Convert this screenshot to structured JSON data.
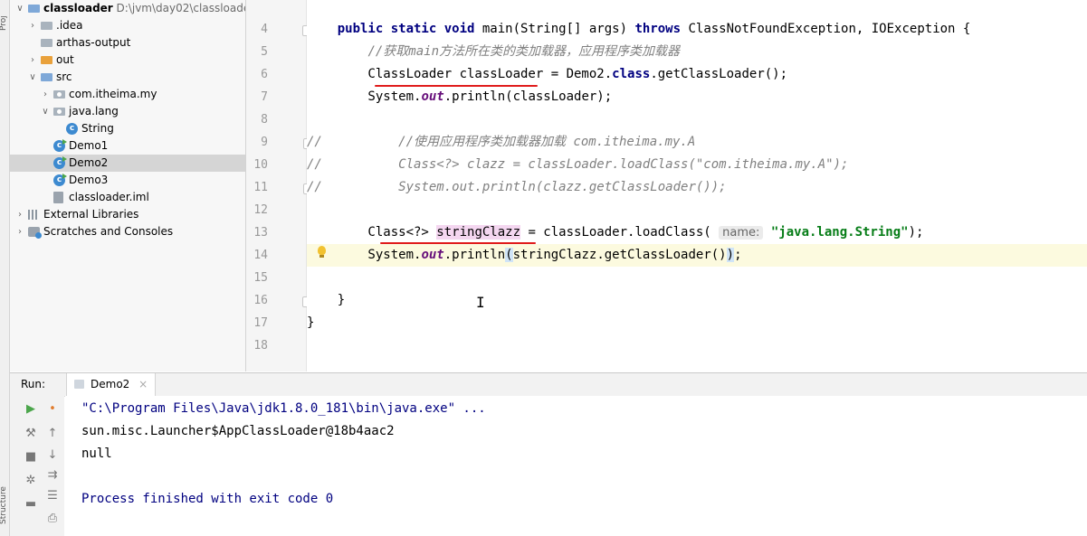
{
  "side_strip": {
    "top_label": "Proj",
    "bottom_label": "Structure"
  },
  "project_tree": [
    {
      "label": "classloader",
      "path": "D:\\jvm\\day02\\classloader",
      "arrow": "v",
      "icon": "folder-blue",
      "bold": true,
      "selected": false
    },
    {
      "label": ".idea",
      "arrow": ">",
      "icon": "folder-gray",
      "selected": false
    },
    {
      "label": "arthas-output",
      "arrow": "",
      "icon": "folder-gray",
      "selected": false
    },
    {
      "label": "out",
      "arrow": ">",
      "icon": "folder-orange",
      "selected": false
    },
    {
      "label": "src",
      "arrow": "v",
      "icon": "folder-blue",
      "selected": false
    },
    {
      "label": "com.itheima.my",
      "arrow": ">",
      "icon": "package",
      "selected": false
    },
    {
      "label": "java.lang",
      "arrow": "v",
      "icon": "package",
      "selected": false
    },
    {
      "label": "String",
      "arrow": "",
      "icon": "class",
      "selected": false
    },
    {
      "label": "Demo1",
      "arrow": "",
      "icon": "class-exec",
      "selected": false
    },
    {
      "label": "Demo2",
      "arrow": "",
      "icon": "class-exec",
      "selected": true
    },
    {
      "label": "Demo3",
      "arrow": "",
      "icon": "class-exec",
      "selected": false
    },
    {
      "label": "classloader.iml",
      "arrow": "",
      "icon": "iml",
      "selected": false
    },
    {
      "label": "External Libraries",
      "arrow": ">",
      "icon": "libraries",
      "selected": false
    },
    {
      "label": "Scratches and Consoles",
      "arrow": ">",
      "icon": "scratches",
      "selected": false
    }
  ],
  "editor": {
    "line_numbers": [
      "4",
      "5",
      "6",
      "7",
      "8",
      "9",
      "10",
      "11",
      "12",
      "13",
      "14",
      "15",
      "16",
      "17",
      "18"
    ],
    "lines": [
      [
        {
          "t": "    "
        },
        {
          "t": "public static void ",
          "c": "kw"
        },
        {
          "t": "main(String[] args) "
        },
        {
          "t": "throws ",
          "c": "kw"
        },
        {
          "t": "ClassNotFoundException, IOException {"
        }
      ],
      [
        {
          "t": "        "
        },
        {
          "t": "//获取main方法所在类的类加载器，应用程序类加载器",
          "c": "cm"
        }
      ],
      [
        {
          "t": "        ClassLoader classLoader = Demo2."
        },
        {
          "t": "class",
          "c": "kw"
        },
        {
          "t": ".getClassLoader();"
        }
      ],
      [
        {
          "t": "        System."
        },
        {
          "t": "out",
          "c": "stat"
        },
        {
          "t": ".println(classLoader);"
        }
      ],
      [],
      [
        {
          "t": "//",
          "c": "cm"
        },
        {
          "t": "          //使用应用程序类加载器加载 com.itheima.my.A",
          "c": "cm"
        }
      ],
      [
        {
          "t": "//",
          "c": "cm"
        },
        {
          "t": "          Class<?> clazz = classLoader.loadClass(\"com.itheima.my.A\");",
          "c": "cm"
        }
      ],
      [
        {
          "t": "//",
          "c": "cm"
        },
        {
          "t": "          System.out.println(clazz.getClassLoader());",
          "c": "cm"
        }
      ],
      [],
      [
        {
          "t": "        Class<?> "
        },
        {
          "t": "stringClazz",
          "c": "pinkbg"
        },
        {
          "t": " = classLoader.loadClass( "
        },
        {
          "t": "name:",
          "c": "hint"
        },
        {
          "t": " "
        },
        {
          "t": "\"java.lang.String\"",
          "c": "str"
        },
        {
          "t": ");"
        }
      ],
      [
        {
          "t": "        System."
        },
        {
          "t": "out",
          "c": "stat"
        },
        {
          "t": ".println"
        },
        {
          "t": "(",
          "c": "bluebg"
        },
        {
          "t": "stringClazz.getClassLoader()"
        },
        {
          "t": ")",
          "c": "bluebg"
        },
        {
          "t": ";"
        }
      ],
      [],
      [
        {
          "t": "    }"
        }
      ],
      [
        {
          "t": "}"
        }
      ],
      []
    ],
    "current_line_index": 10,
    "cursor_glyph": "I"
  },
  "run_panel": {
    "label": "Run:",
    "tab_label": "Demo2",
    "tab_close": "×",
    "output": [
      {
        "text": "\"C:\\Program Files\\Java\\jdk1.8.0_181\\bin\\java.exe\" ...",
        "kind": "cmd"
      },
      {
        "text": "sun.misc.Launcher$AppClassLoader@18b4aac2",
        "kind": "out"
      },
      {
        "text": "null",
        "kind": "out"
      },
      {
        "text": "",
        "kind": "out"
      },
      {
        "text": "Process finished with exit code 0",
        "kind": "cmd"
      }
    ]
  },
  "colors": {
    "annotation_red": "#e01b1b",
    "current_line": "#fcfadf",
    "keyword": "#000080",
    "string": "#067d17"
  }
}
